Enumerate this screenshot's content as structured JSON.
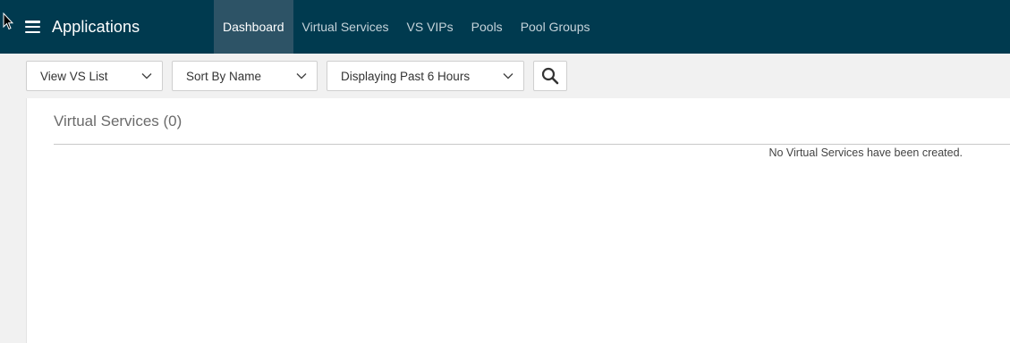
{
  "header": {
    "app_title": "Applications",
    "tabs": [
      {
        "label": "Dashboard",
        "active": true
      },
      {
        "label": "Virtual Services",
        "active": false
      },
      {
        "label": "VS VIPs",
        "active": false
      },
      {
        "label": "Pools",
        "active": false
      },
      {
        "label": "Pool Groups",
        "active": false
      }
    ]
  },
  "toolbar": {
    "view_dropdown": "View VS List",
    "sort_dropdown": "Sort By Name",
    "time_dropdown": "Displaying Past 6 Hours",
    "search_icon": "search-icon"
  },
  "panel": {
    "title": "Virtual Services (0)",
    "empty_message": "No Virtual Services have been created."
  },
  "colors": {
    "header_bg": "#003a4f",
    "active_tab_bg": "#2d5366",
    "page_bg": "#f1f1f1"
  }
}
